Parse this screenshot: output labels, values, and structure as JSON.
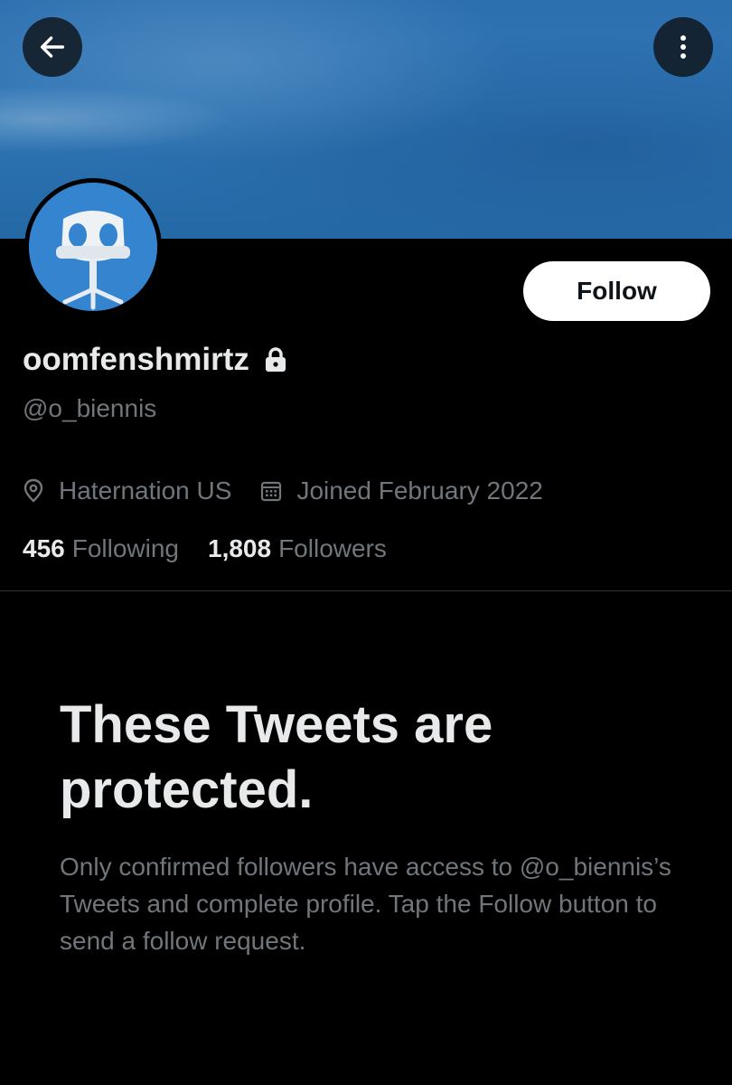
{
  "profile": {
    "display_name": "oomfenshmirtz",
    "handle": "@o_biennis",
    "location": "Haternation US",
    "joined": "Joined February 2022",
    "following_count": "456",
    "following_label": "Following",
    "followers_count": "1,808",
    "followers_label": "Followers",
    "protected": true
  },
  "actions": {
    "follow_label": "Follow",
    "back_icon": "arrow-left-icon",
    "more_icon": "more-vertical-icon"
  },
  "protected_notice": {
    "title": "These Tweets are protected.",
    "body": "Only confirmed followers have access to @o_biennis’s Tweets and complete profile. Tap the Follow button to send a follow request."
  },
  "colors": {
    "background": "#000000",
    "banner": "#2f75b4",
    "primary_text": "#e7e9ea",
    "secondary_text": "#71767b",
    "follow_button_bg": "#ffffff",
    "follow_button_text": "#0f1419",
    "divider": "#2f3336"
  }
}
